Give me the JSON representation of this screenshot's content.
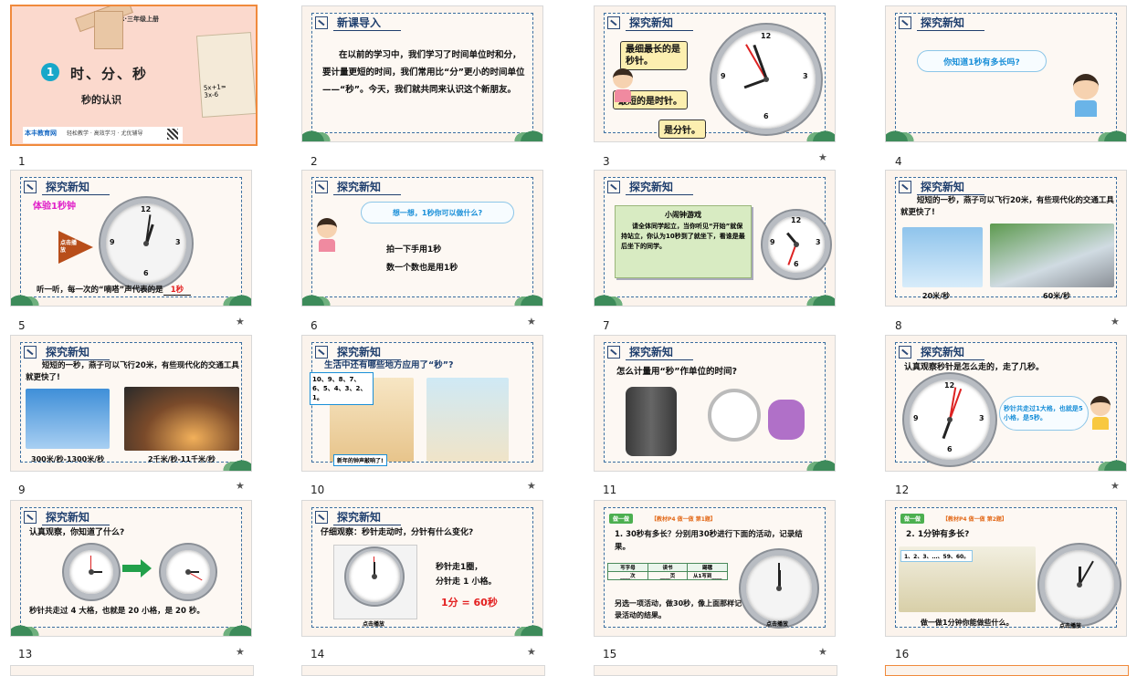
{
  "slides": [
    {
      "num": "1",
      "cover": {
        "badge": "1",
        "title": "时、分、秒",
        "subtitle": "秒的认识",
        "grade": "R·三年级上册",
        "brand": "本丰教育网",
        "slogan": "轻松教学 · 高效学习 · 尤优辅导",
        "math1": "5x+1=",
        "math2": "3x-6"
      }
    },
    {
      "num": "2",
      "header": "新课导入",
      "text": "在以前的学习中，我们学习了时间单位时和分，要计量更短的时间，我们常用比“分”更小的时间单位——“秒”。今天，我们就共同来认识这个新朋友。",
      "highlight": "秒"
    },
    {
      "num": "3",
      "header": "探究新知",
      "callouts": [
        "最细最长的是秒针。",
        "最短的是时针。",
        "是分针。"
      ],
      "red": [
        "秒针",
        "时针",
        "分针"
      ]
    },
    {
      "num": "4",
      "header": "探究新知",
      "bubble": "你知道1秒有多长吗?"
    },
    {
      "num": "5",
      "header": "探究新知",
      "label": "体验1秒钟",
      "arrow_label": "点击播放",
      "caption": "听一听，每一次的“嘀嗒”声代表的是",
      "answer": "1秒"
    },
    {
      "num": "6",
      "header": "探究新知",
      "bubble": "想一想，1秒你可以做什么?",
      "lines": [
        "拍一下手用1秒",
        "数一个数也是用1秒"
      ]
    },
    {
      "num": "7",
      "header": "探究新知",
      "box_title": "小闹钟游戏",
      "box_text": "请全体同学起立，当你听见“开始”就保持站立，你认为10秒到了就坐下，看谁是最后坐下的同学。"
    },
    {
      "num": "8",
      "header": "探究新知",
      "text": "短短的一秒，燕子可以飞行20米，有些现代化的交通工具就更快了!",
      "captions": [
        "20米/秒",
        "60米/秒"
      ]
    },
    {
      "num": "9",
      "header": "探究新知",
      "text": "短短的一秒，燕子可以飞行20米，有些现代化的交通工具就更快了!",
      "captions": [
        "300米/秒-1300米/秒",
        "2千米/秒-11千米/秒"
      ]
    },
    {
      "num": "10",
      "header": "探究新知",
      "question": "生活中还有哪些地方应用了“秒”?",
      "countdown": "10、9、8、7、6、5、4、3、2、1。",
      "banner": "新年的钟声敲响了!"
    },
    {
      "num": "11",
      "header": "探究新知",
      "question": "怎么计量用“秒”作单位的时间?"
    },
    {
      "num": "12",
      "header": "探究新知",
      "text": "认真观察秒针是怎么走的，走了几秒。",
      "bubble": "秒针共走过1大格，也就是5小格，是5秒。"
    },
    {
      "num": "13",
      "header": "探究新知",
      "text": "认真观察，你知道了什么?",
      "fill": "秒针共走过 4 大格，也就是 20 小格，是 20 秒。"
    },
    {
      "num": "14",
      "header": "探究新知",
      "text": "仔细观察：秒针走动时，分针有什么变化?",
      "l1": "秒针走1圈，",
      "l2": "分针走 1 小格。",
      "formula": "1分 = 60秒",
      "tag": "点击播放"
    },
    {
      "num": "15",
      "tag": "做一做",
      "ref": "【教材P4 做一做 第1题】",
      "q": "1. 30秒有多长？分别用30秒进行下面的活动，记录结果。",
      "table_head": [
        "写字母",
        "读书",
        "踢毽"
      ],
      "table_row": [
        "____次",
        "____页",
        "从1写到____"
      ],
      "note": "另选一项活动，做30秒，像上面那样记录活动的结果。",
      "play": "点击播放"
    },
    {
      "num": "16",
      "tag": "做一做",
      "ref": "【教材P4 做一做 第2题】",
      "q": "2. 1分钟有多长?",
      "counting": "1、2、3、…、59、60。",
      "note": "做一做1分钟你能做些什么。",
      "play": "点击播放"
    }
  ],
  "page_stars": "★",
  "colors": {
    "accent": "#1f3f6e",
    "highlight": "#e32020",
    "selection": "#f08a3c"
  }
}
